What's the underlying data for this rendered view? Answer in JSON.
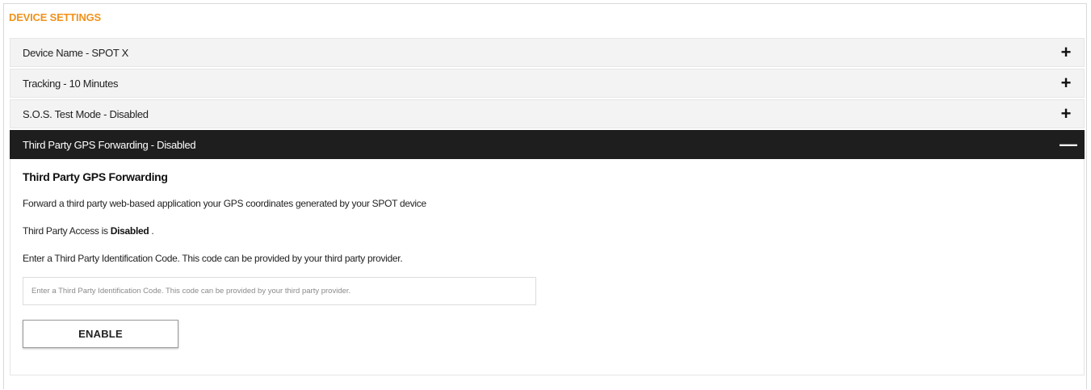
{
  "section_title": "DEVICE SETTINGS",
  "colors": {
    "accent": "#f0921b",
    "active_header_bg": "#1e1e1e",
    "row_bg": "#f3f3f3"
  },
  "accordion": {
    "items": [
      {
        "label": "Device Name - SPOT X",
        "toggle": "+",
        "toggle_icon": "plus-icon",
        "expanded": false
      },
      {
        "label": "Tracking - 10 Minutes",
        "toggle": "+",
        "toggle_icon": "plus-icon",
        "expanded": false
      },
      {
        "label": "S.O.S. Test Mode - Disabled",
        "toggle": "+",
        "toggle_icon": "plus-icon",
        "expanded": false
      },
      {
        "label": "Third Party GPS Forwarding - Disabled",
        "toggle": "—",
        "toggle_icon": "minus-icon",
        "expanded": true
      }
    ]
  },
  "panel": {
    "heading": "Third Party GPS Forwarding",
    "description": "Forward a third party web-based application your GPS coordinates generated by your SPOT device",
    "access_prefix": "Third Party Access is ",
    "access_status": "Disabled",
    "access_suffix": " .",
    "instruction": "Enter a Third Party Identification Code. This code can be provided by your third party provider.",
    "input": {
      "value": "",
      "placeholder": "Enter a Third Party Identification Code. This code can be provided by your third party provider."
    },
    "enable_button": "ENABLE"
  }
}
